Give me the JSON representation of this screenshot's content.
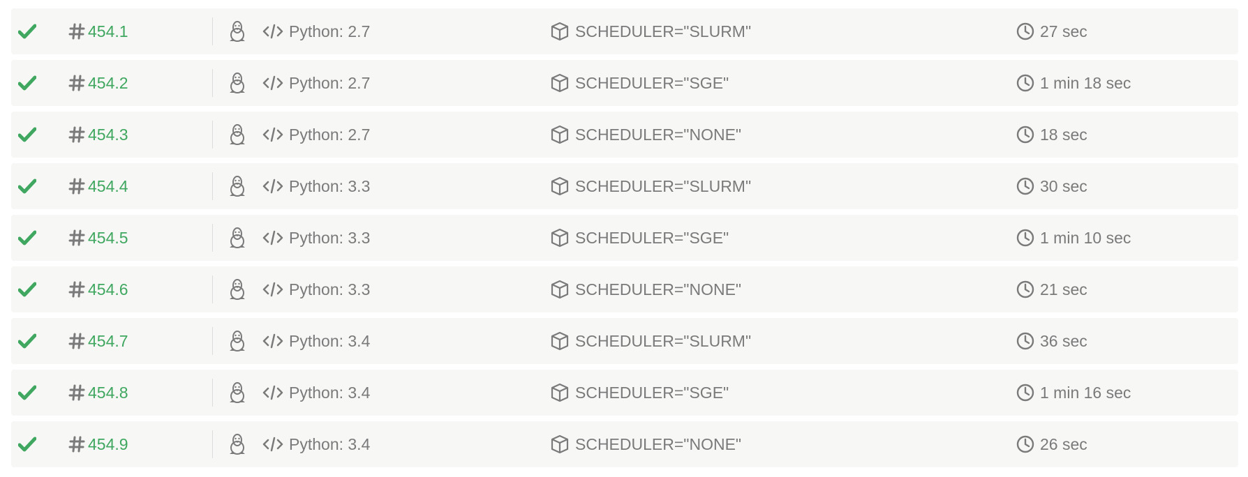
{
  "colors": {
    "passed": "#3fa75f",
    "text": "#7a7a7a",
    "row_bg": "#f7f7f6"
  },
  "icons": {
    "status": "check-icon",
    "number": "hash-icon",
    "os": "linux-penguin-icon",
    "language": "code-icon",
    "env": "package-cube-icon",
    "duration": "clock-icon"
  },
  "jobs": [
    {
      "number": "454.1",
      "language": "Python: 2.7",
      "env": "SCHEDULER=\"SLURM\"",
      "duration": "27 sec"
    },
    {
      "number": "454.2",
      "language": "Python: 2.7",
      "env": "SCHEDULER=\"SGE\"",
      "duration": "1 min 18 sec"
    },
    {
      "number": "454.3",
      "language": "Python: 2.7",
      "env": "SCHEDULER=\"NONE\"",
      "duration": "18 sec"
    },
    {
      "number": "454.4",
      "language": "Python: 3.3",
      "env": "SCHEDULER=\"SLURM\"",
      "duration": "30 sec"
    },
    {
      "number": "454.5",
      "language": "Python: 3.3",
      "env": "SCHEDULER=\"SGE\"",
      "duration": "1 min 10 sec"
    },
    {
      "number": "454.6",
      "language": "Python: 3.3",
      "env": "SCHEDULER=\"NONE\"",
      "duration": "21 sec"
    },
    {
      "number": "454.7",
      "language": "Python: 3.4",
      "env": "SCHEDULER=\"SLURM\"",
      "duration": "36 sec"
    },
    {
      "number": "454.8",
      "language": "Python: 3.4",
      "env": "SCHEDULER=\"SGE\"",
      "duration": "1 min 16 sec"
    },
    {
      "number": "454.9",
      "language": "Python: 3.4",
      "env": "SCHEDULER=\"NONE\"",
      "duration": "26 sec"
    }
  ]
}
